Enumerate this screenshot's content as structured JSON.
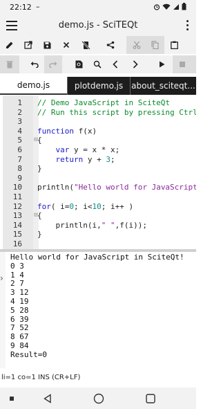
{
  "status_bar": {
    "time": "22:12",
    "indicator": "–",
    "icons": [
      "sim-icon",
      "alarm-icon",
      "wifi-icon",
      "signal-icon",
      "battery-icon"
    ]
  },
  "app": {
    "title": "demo.js - SciTEQt",
    "menu_icon": "hamburger-menu-icon",
    "overflow_icon": "more-vert-icon"
  },
  "toolbar_row1": [
    {
      "name": "edit-icon",
      "enabled": true
    },
    {
      "name": "open-icon",
      "enabled": true
    },
    {
      "name": "save-icon",
      "enabled": true
    },
    {
      "name": "close-icon",
      "enabled": true
    },
    {
      "name": "no-mobile-icon",
      "enabled": true
    },
    {
      "name": "share-icon",
      "enabled": true
    },
    {
      "name": "cut-icon",
      "enabled": false
    },
    {
      "name": "copy-icon",
      "enabled": false
    },
    {
      "name": "paste-icon",
      "enabled": true
    }
  ],
  "toolbar_row2": [
    {
      "name": "delete-icon",
      "enabled": false
    },
    {
      "name": "undo-icon",
      "enabled": true
    },
    {
      "name": "redo-icon",
      "enabled": false
    },
    {
      "name": "find-icon",
      "enabled": true
    },
    {
      "name": "search-icon",
      "enabled": true
    },
    {
      "name": "prev-icon",
      "enabled": true
    },
    {
      "name": "next-icon",
      "enabled": true
    },
    {
      "name": "run-icon",
      "enabled": true
    },
    {
      "name": "stop-icon",
      "enabled": false
    }
  ],
  "tabs": [
    {
      "label": "demo.js",
      "active": true
    },
    {
      "label": "plotdemo.js",
      "active": false
    },
    {
      "label": "about_sciteqt...",
      "active": false
    }
  ],
  "editor": {
    "lines": [
      {
        "n": "1",
        "tokens": [
          [
            "c-com",
            "// Demo JavaScript in SciteQt"
          ]
        ]
      },
      {
        "n": "2",
        "tokens": [
          [
            "c-com",
            "// Run this script by pressing Ctrl+R"
          ]
        ]
      },
      {
        "n": "3",
        "tokens": []
      },
      {
        "n": "4",
        "tokens": [
          [
            "c-kw",
            "function"
          ],
          [
            "c-plain",
            " f(x)"
          ]
        ]
      },
      {
        "n": "5",
        "tokens": [
          [
            "c-plain",
            "{"
          ]
        ],
        "fold": true
      },
      {
        "n": "6",
        "tokens": [
          [
            "c-plain",
            "    "
          ],
          [
            "c-kw",
            "var"
          ],
          [
            "c-plain",
            " y = x * x;"
          ]
        ]
      },
      {
        "n": "7",
        "tokens": [
          [
            "c-plain",
            "    "
          ],
          [
            "c-kw",
            "return"
          ],
          [
            "c-plain",
            " y + "
          ],
          [
            "c-num",
            "3"
          ],
          [
            "c-plain",
            ";"
          ]
        ]
      },
      {
        "n": "8",
        "tokens": [
          [
            "c-plain",
            "}"
          ]
        ]
      },
      {
        "n": "9",
        "tokens": []
      },
      {
        "n": "10",
        "tokens": [
          [
            "c-plain",
            "println("
          ],
          [
            "c-str",
            "\"Hello world for JavaScript\""
          ],
          [
            "c-plain",
            ");"
          ]
        ]
      },
      {
        "n": "11",
        "tokens": []
      },
      {
        "n": "12",
        "tokens": [
          [
            "c-kw",
            "for"
          ],
          [
            "c-plain",
            "( i="
          ],
          [
            "c-num",
            "0"
          ],
          [
            "c-plain",
            "; i<"
          ],
          [
            "c-num",
            "10"
          ],
          [
            "c-plain",
            "; i++ )"
          ]
        ]
      },
      {
        "n": "13",
        "tokens": [
          [
            "c-plain",
            "{"
          ]
        ],
        "fold": true
      },
      {
        "n": "14",
        "tokens": [
          [
            "c-plain",
            "    println(i,"
          ],
          [
            "c-str",
            "\" \""
          ],
          [
            "c-plain",
            ",f(i));"
          ]
        ]
      },
      {
        "n": "15",
        "tokens": [
          [
            "c-plain",
            "}"
          ]
        ]
      },
      {
        "n": "16",
        "tokens": []
      }
    ]
  },
  "output": {
    "lines": [
      "Hello world for JavaScript in SciteQt!",
      "0 3",
      "1 4",
      "2 7",
      "3 12",
      "4 19",
      "5 28",
      "6 39",
      "7 52",
      "8 67",
      "9 84",
      "Result=0"
    ]
  },
  "status_line": "li=1 co=1 INS (CR+LF)",
  "navbar": [
    "overview-icon",
    "back-icon",
    "home-icon",
    "recents-icon"
  ]
}
